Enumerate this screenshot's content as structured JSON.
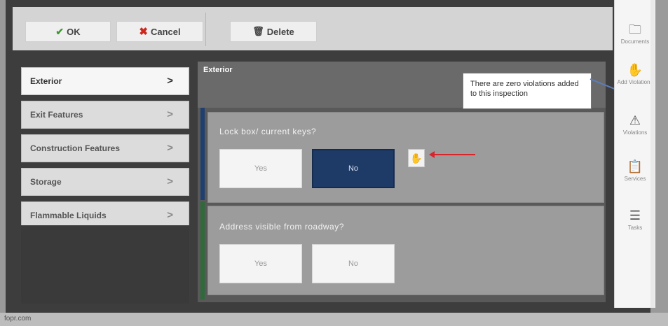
{
  "toolbar": {
    "ok_label": "OK",
    "cancel_label": "Cancel",
    "delete_label": "Delete"
  },
  "nav": {
    "items": [
      {
        "label": "Exterior",
        "chevron": ">",
        "active": true
      },
      {
        "label": "Exit Features",
        "chevron": ">",
        "active": false
      },
      {
        "label": "Construction Features",
        "chevron": ">",
        "active": false
      },
      {
        "label": "Storage",
        "chevron": ">",
        "active": false
      },
      {
        "label": "Flammable Liquids",
        "chevron": ">",
        "active": false
      }
    ]
  },
  "main": {
    "section_title": "Exterior",
    "questions": [
      {
        "text": "Lock box/ current keys?",
        "yes_label": "Yes",
        "no_label": "No",
        "selected": "No"
      },
      {
        "text": "Address visible from roadway?",
        "yes_label": "Yes",
        "no_label": "No",
        "selected": null
      }
    ]
  },
  "tooltip": {
    "text": "There are zero violations added to this inspection"
  },
  "rail": {
    "items": [
      {
        "label": "Documents",
        "icon": "folder-icon"
      },
      {
        "label": "Add Violations",
        "icon": "hand-icon"
      },
      {
        "label": "Violations",
        "icon": "warning-icon"
      },
      {
        "label": "Services",
        "icon": "clipboard-icon"
      },
      {
        "label": "Tasks",
        "icon": "tasks-icon"
      }
    ]
  },
  "footer": {
    "text": "fopr.com"
  },
  "colors": {
    "selected_answer": "#1e3a66",
    "ok_green": "#3c9a2e",
    "cancel_red": "#d0271d",
    "annotation_arrow": "#d9242a"
  }
}
